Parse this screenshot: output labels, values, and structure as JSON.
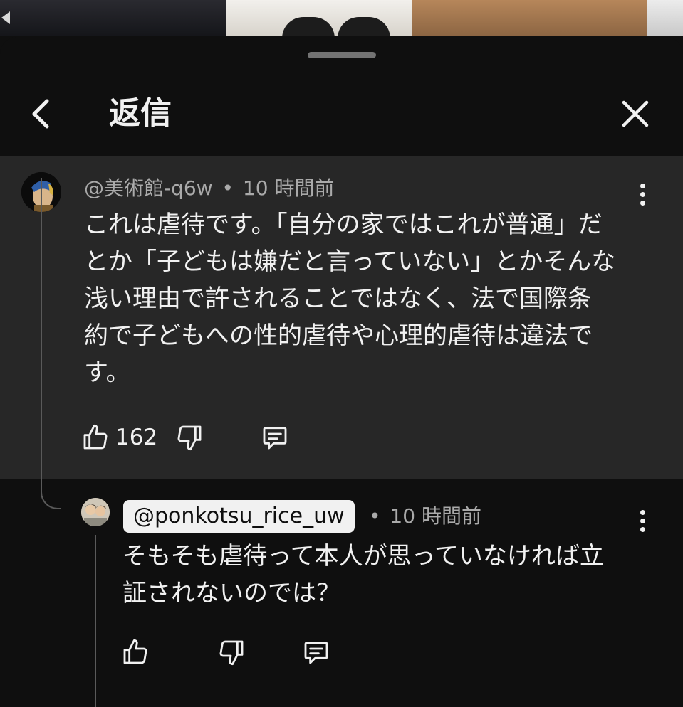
{
  "sheet": {
    "title": "返信"
  },
  "parent_comment": {
    "author": "@美術館-q6w",
    "separator": "•",
    "time": "10 時間前",
    "lines": [
      "これは虐待です。「自分の家ではこれが普通」だ",
      "とか「子どもは嫌だと言っていない」とかそんな",
      "浅い理由で許されることではなく、法で国際条",
      "約で子どもへの性的虐待や心理的虐待は違法で",
      "す。"
    ],
    "likes": "162"
  },
  "reply": {
    "author": "@ponkotsu_rice_uw",
    "separator": "•",
    "time": "10 時間前",
    "lines": [
      "そもそも虐待って本人が思っていなければ立",
      "証されないのでは？"
    ]
  },
  "icons": {
    "back": "chevron-left-icon",
    "close": "close-icon",
    "more": "more-vertical-icon",
    "like": "thumbs-up-icon",
    "dislike": "thumbs-down-icon",
    "reply": "comment-icon"
  },
  "colors": {
    "background": "#0f0f0f",
    "comment_highlight": "#272727",
    "text_primary": "#f1f1f1",
    "text_secondary": "#aaaaaa",
    "mention_chip": "#f1f1f1"
  }
}
